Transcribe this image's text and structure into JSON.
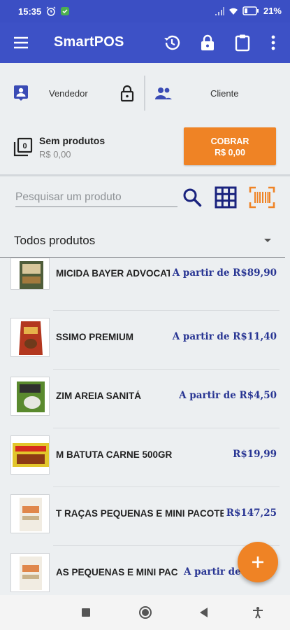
{
  "status_bar": {
    "time": "15:35",
    "battery": "21%",
    "icons": [
      "alarm-icon",
      "app-notification-icon",
      "signal-icon",
      "wifi-icon",
      "battery-icon"
    ]
  },
  "app_bar": {
    "title": "SmartPOS",
    "actions": [
      "history-icon",
      "lock-icon",
      "clipboard-icon",
      "more-vert-icon"
    ],
    "color": "#3d51c6"
  },
  "parties": {
    "vendor_label": "Vendedor",
    "client_label": "Cliente"
  },
  "cart": {
    "title": "Sem produtos",
    "total": "R$ 0,00",
    "count": "0",
    "charge_label": "COBRAR",
    "charge_amount": "R$ 0,00",
    "accent": "#ef8325"
  },
  "search": {
    "placeholder": "Pesquisar um produto",
    "value": ""
  },
  "category": {
    "selected": "Todos produtos"
  },
  "products": [
    {
      "name": "MICIDA BAYER ADVOCATE",
      "price": "A partir de R$89,90",
      "price_color": "#283593"
    },
    {
      "name": "SSIMO PREMIUM",
      "price": "A partir de R$11,40",
      "price_color": "#283593"
    },
    {
      "name": "ZIM              AREIA SANITÁ",
      "price": "A partir de R$4,50",
      "price_color": "#283593"
    },
    {
      "name": "M BATUTA CARNE 500GR",
      "price": "R$19,99",
      "price_color": "#283593"
    },
    {
      "name": "T RAÇAS PEQUENAS E MINI PACOTE",
      "price": "R$147,25",
      "price_color": "#283593"
    },
    {
      "name": "AS PEQUENAS E MINI PACO",
      "price": "A partir de R$",
      "price_color": "#283593"
    }
  ],
  "fab": {
    "icon": "plus-icon"
  },
  "nav_bar": {
    "buttons": [
      "recents-icon",
      "home-icon",
      "back-icon",
      "accessibility-icon"
    ]
  }
}
